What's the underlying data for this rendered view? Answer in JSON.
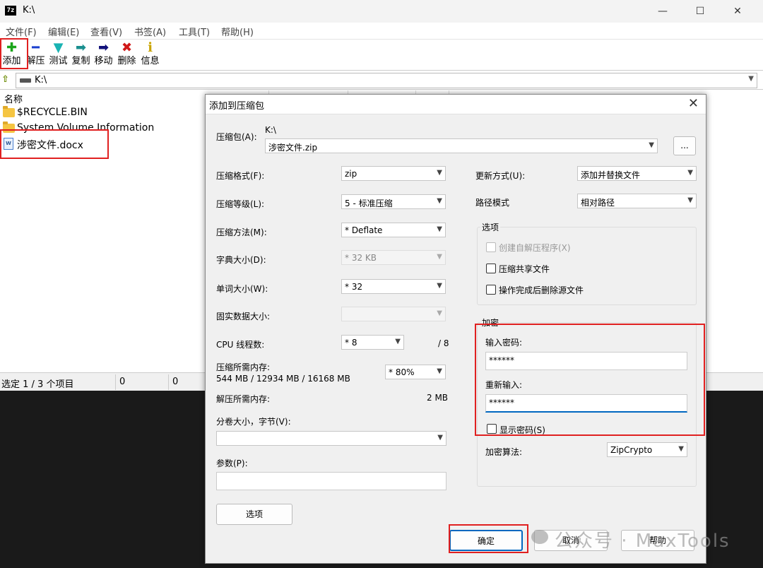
{
  "main_window": {
    "app_icon_text": "7z",
    "title": "K:\\",
    "controls": {
      "minimize": "—",
      "maximize": "☐",
      "close": "✕"
    },
    "menu": [
      "文件(F)",
      "编辑(E)",
      "查看(V)",
      "书签(A)",
      "工具(T)",
      "帮助(H)"
    ],
    "toolbar": [
      {
        "label": "添加",
        "icon": "add-icon",
        "glyph": "✚",
        "color": "#1aa51a"
      },
      {
        "label": "解压",
        "icon": "extract-icon",
        "glyph": "━",
        "color": "#1a3fcf"
      },
      {
        "label": "测试",
        "icon": "test-icon",
        "glyph": "▼",
        "color": "#1ab3b3"
      },
      {
        "label": "复制",
        "icon": "copy-icon",
        "glyph": "➡",
        "color": "#1a8f8f"
      },
      {
        "label": "移动",
        "icon": "move-icon",
        "glyph": "➡",
        "color": "#12127a"
      },
      {
        "label": "删除",
        "icon": "delete-icon",
        "glyph": "✖",
        "color": "#d01818"
      },
      {
        "label": "信息",
        "icon": "info-icon",
        "glyph": "ℹ",
        "color": "#c9a400"
      }
    ],
    "address": {
      "path": "K:\\"
    },
    "file_list": {
      "column_name": "名称",
      "items": [
        {
          "name": "$RECYCLE.BIN",
          "icon": "folder-icon"
        },
        {
          "name": "System Volume Information",
          "icon": "folder-icon"
        },
        {
          "name": "涉密文件.docx",
          "icon": "word-document-icon"
        }
      ]
    },
    "status": {
      "selection": "选定 1 / 3 个项目",
      "size": "0",
      "packed": "0"
    }
  },
  "dialog": {
    "title": "添加到压缩包",
    "archive_label": "压缩包(A):",
    "archive_dir": "K:\\",
    "archive_name": "涉密文件.zip",
    "browse_label": "...",
    "format_label": "压缩格式(F):",
    "format_value": "zip",
    "level_label": "压缩等级(L):",
    "level_value": "5 - 标准压缩",
    "method_label": "压缩方法(M):",
    "method_value": "* Deflate",
    "dict_label": "字典大小(D):",
    "dict_value": "* 32 KB",
    "word_label": "单词大小(W):",
    "word_value": "* 32",
    "solid_label": "固实数据大小:",
    "solid_value": "",
    "threads_label": "CPU 线程数:",
    "threads_value": "* 8",
    "threads_max": "/ 8",
    "mem_compress_label": "压缩所需内存:",
    "mem_compress_value": "544 MB / 12934 MB / 16168 MB",
    "mem_percent": "* 80%",
    "mem_decompress_label": "解压所需内存:",
    "mem_decompress_value": "2 MB",
    "split_label": "分卷大小，字节(V):",
    "split_value": "",
    "params_label": "参数(P):",
    "params_value": "",
    "options_button": "选项",
    "update_label": "更新方式(U):",
    "update_value": "添加并替换文件",
    "path_label": "路径模式",
    "path_value": "相对路径",
    "options_group": "选项",
    "opt_sfx": "创建自解压程序(X)",
    "opt_shared": "压缩共享文件",
    "opt_delete": "操作完成后删除源文件",
    "encrypt_group": "加密",
    "password_label": "输入密码:",
    "password_value": "******",
    "reenter_label": "重新输入:",
    "reenter_value": "******",
    "show_password_label": "显示密码(S)",
    "method_enc_label": "加密算法:",
    "method_enc_value": "ZipCrypto",
    "ok_button": "确定",
    "cancel_button": "取消",
    "help_button": "帮助"
  },
  "watermark": {
    "text": "公众号 · MaxTools"
  },
  "highlight_color": "#e02020"
}
